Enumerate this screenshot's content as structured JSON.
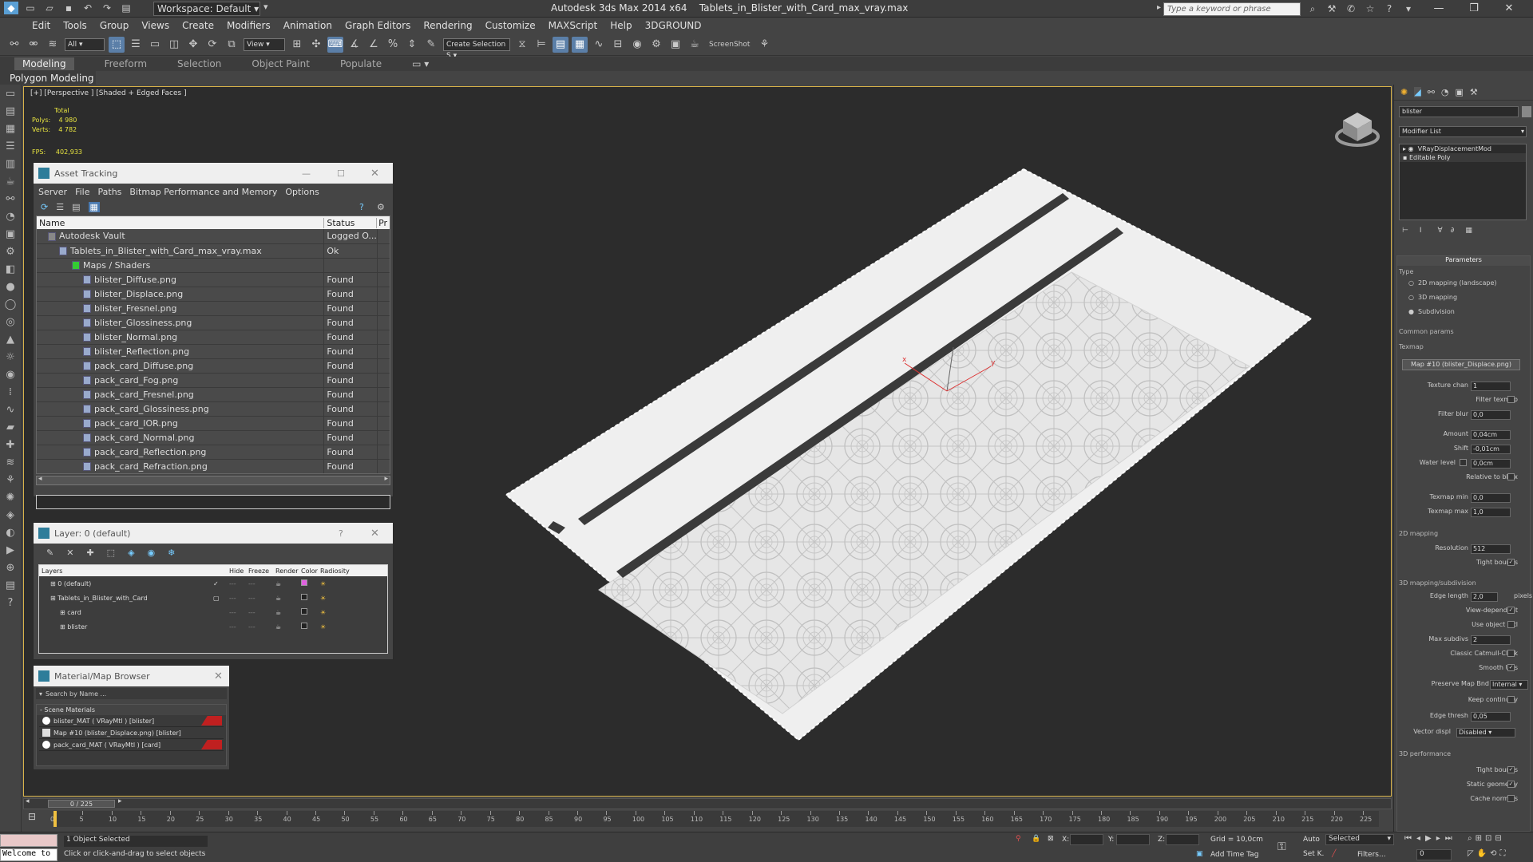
{
  "app": {
    "title": "Autodesk 3ds Max  2014 x64",
    "file": "Tablets_in_Blister_with_Card_max_vray.max",
    "workspace": "Workspace: Default",
    "search_placeholder": "Type a keyword or phrase"
  },
  "menus": [
    "Edit",
    "Tools",
    "Group",
    "Views",
    "Create",
    "Modifiers",
    "Animation",
    "Graph Editors",
    "Rendering",
    "Customize",
    "MAXScript",
    "Help",
    "3DGROUND"
  ],
  "toolbar": {
    "filter": "All",
    "refcoord": "View",
    "selection_set": "Create Selection S",
    "screenshot": "ScreenShot"
  },
  "ribbon": {
    "tabs": [
      "Modeling",
      "Freeform",
      "Selection",
      "Object Paint",
      "Populate"
    ],
    "active": "Modeling",
    "subtab": "Polygon Modeling"
  },
  "viewport": {
    "label": "[+] [Perspective ] [Shaded + Edged Faces ]",
    "stats_total": "Total",
    "polys_label": "Polys:",
    "polys": "4 980",
    "verts_label": "Verts:",
    "verts": "4 782",
    "fps_label": "FPS:",
    "fps": "402,933"
  },
  "asset_tracking": {
    "title": "Asset Tracking",
    "menu": [
      "Server",
      "File",
      "Paths",
      "Bitmap Performance and Memory",
      "Options"
    ],
    "columns": [
      "Name",
      "Status",
      "Pr"
    ],
    "rows": [
      {
        "name": "Autodesk Vault",
        "status": "Logged O..."
      },
      {
        "name": "Tablets_in_Blister_with_Card_max_vray.max",
        "status": "Ok"
      },
      {
        "name": "Maps / Shaders",
        "status": ""
      },
      {
        "name": "blister_Diffuse.png",
        "status": "Found"
      },
      {
        "name": "blister_Displace.png",
        "status": "Found"
      },
      {
        "name": "blister_Fresnel.png",
        "status": "Found"
      },
      {
        "name": "blister_Glossiness.png",
        "status": "Found"
      },
      {
        "name": "blister_Normal.png",
        "status": "Found"
      },
      {
        "name": "blister_Reflection.png",
        "status": "Found"
      },
      {
        "name": "pack_card_Diffuse.png",
        "status": "Found"
      },
      {
        "name": "pack_card_Fog.png",
        "status": "Found"
      },
      {
        "name": "pack_card_Fresnel.png",
        "status": "Found"
      },
      {
        "name": "pack_card_Glossiness.png",
        "status": "Found"
      },
      {
        "name": "pack_card_IOR.png",
        "status": "Found"
      },
      {
        "name": "pack_card_Normal.png",
        "status": "Found"
      },
      {
        "name": "pack_card_Reflection.png",
        "status": "Found"
      },
      {
        "name": "pack_card_Refraction.png",
        "status": "Found"
      }
    ]
  },
  "layer_panel": {
    "title": "Layer: 0 (default)",
    "columns": [
      "Layers",
      "Hide",
      "Freeze",
      "Render",
      "Color",
      "Radiosity"
    ],
    "rows": [
      {
        "name": "0 (default)",
        "color": "#e060e0"
      },
      {
        "name": "Tablets_in_Blister_with_Card",
        "color": "#222222"
      },
      {
        "name": "card",
        "color": "#222222"
      },
      {
        "name": "blister",
        "color": "#222222"
      }
    ]
  },
  "material_browser": {
    "title": "Material/Map Browser",
    "search_placeholder": "Search by Name ...",
    "group": "- Scene Materials",
    "items": [
      "blister_MAT ( VRayMtl ) [blister]",
      "Map #10 (blister_Displace.png) [blister]",
      "pack_card_MAT ( VRayMtl ) [card]"
    ]
  },
  "command_panel": {
    "object_name": "blister",
    "modifier_list": "Modifier List",
    "stack": [
      "VRayDisplacementMod",
      "Editable Poly"
    ],
    "params_title": "Parameters",
    "type_label": "Type",
    "type_options": [
      "2D mapping (landscape)",
      "3D mapping",
      "Subdivision"
    ],
    "common": "Common params",
    "texmap_label": "Texmap",
    "texmap": "Map #10 (blister_Displace.png)",
    "texture_chan": "Texture chan",
    "texture_chan_v": "1",
    "filter_texmap": "Filter texmap",
    "filter_blur": "Filter blur",
    "filter_blur_v": "0,0",
    "amount": "Amount",
    "amount_v": "0,04cm",
    "shift": "Shift",
    "shift_v": "-0,01cm",
    "water_level": "Water level",
    "water_level_v": "0,0cm",
    "relative_bbox": "Relative to bbox",
    "texmap_min": "Texmap min",
    "texmap_min_v": "0,0",
    "texmap_max": "Texmap max",
    "texmap_max_v": "1,0",
    "mapping2d": "2D mapping",
    "resolution": "Resolution",
    "resolution_v": "512",
    "tight_bounds": "Tight bounds",
    "mapping3d": "3D mapping/subdivision",
    "edge_length": "Edge length",
    "edge_length_v": "2,0",
    "pixels": "pixels",
    "view_dependent": "View-dependent",
    "use_object_mtl": "Use object mtl",
    "max_subdivs": "Max subdivs",
    "max_subdivs_v": "2",
    "catmull": "Classic Catmull-Clark",
    "smooth_uvs": "Smooth UVs",
    "preserve_map": "Preserve Map Bnd",
    "preserve_map_v": "Internal",
    "keep_cont": "Keep continuity",
    "edge_thresh": "Edge thresh",
    "edge_thresh_v": "0,05",
    "vector_displ": "Vector displ",
    "vector_displ_v": "Disabled",
    "perf": "3D performance",
    "tight_bounds2": "Tight bounds",
    "static_geom": "Static geometry",
    "cache_normals": "Cache normals"
  },
  "timeline": {
    "frame": "0 / 225",
    "ticks": [
      "0",
      "5",
      "10",
      "15",
      "20",
      "25",
      "30",
      "35",
      "40",
      "45",
      "50",
      "55",
      "60",
      "65",
      "70",
      "75",
      "80",
      "85",
      "90",
      "95",
      "100",
      "105",
      "110",
      "115",
      "120",
      "125",
      "130",
      "135",
      "140",
      "145",
      "150",
      "155",
      "160",
      "165",
      "170",
      "175",
      "180",
      "185",
      "190",
      "195",
      "200",
      "205",
      "210",
      "215",
      "220",
      "225"
    ]
  },
  "status": {
    "maxscript": "Welcome to",
    "selected": "1 Object Selected",
    "prompt": "Click or click-and-drag to select objects",
    "x": "X:",
    "y": "Y:",
    "z": "Z:",
    "grid": "Grid = 10,0cm",
    "add_time_tag": "Add Time Tag",
    "auto": "Auto",
    "setk": "Set K.",
    "selected_drop": "Selected",
    "filters": "Filters...",
    "frame_field": "0"
  }
}
